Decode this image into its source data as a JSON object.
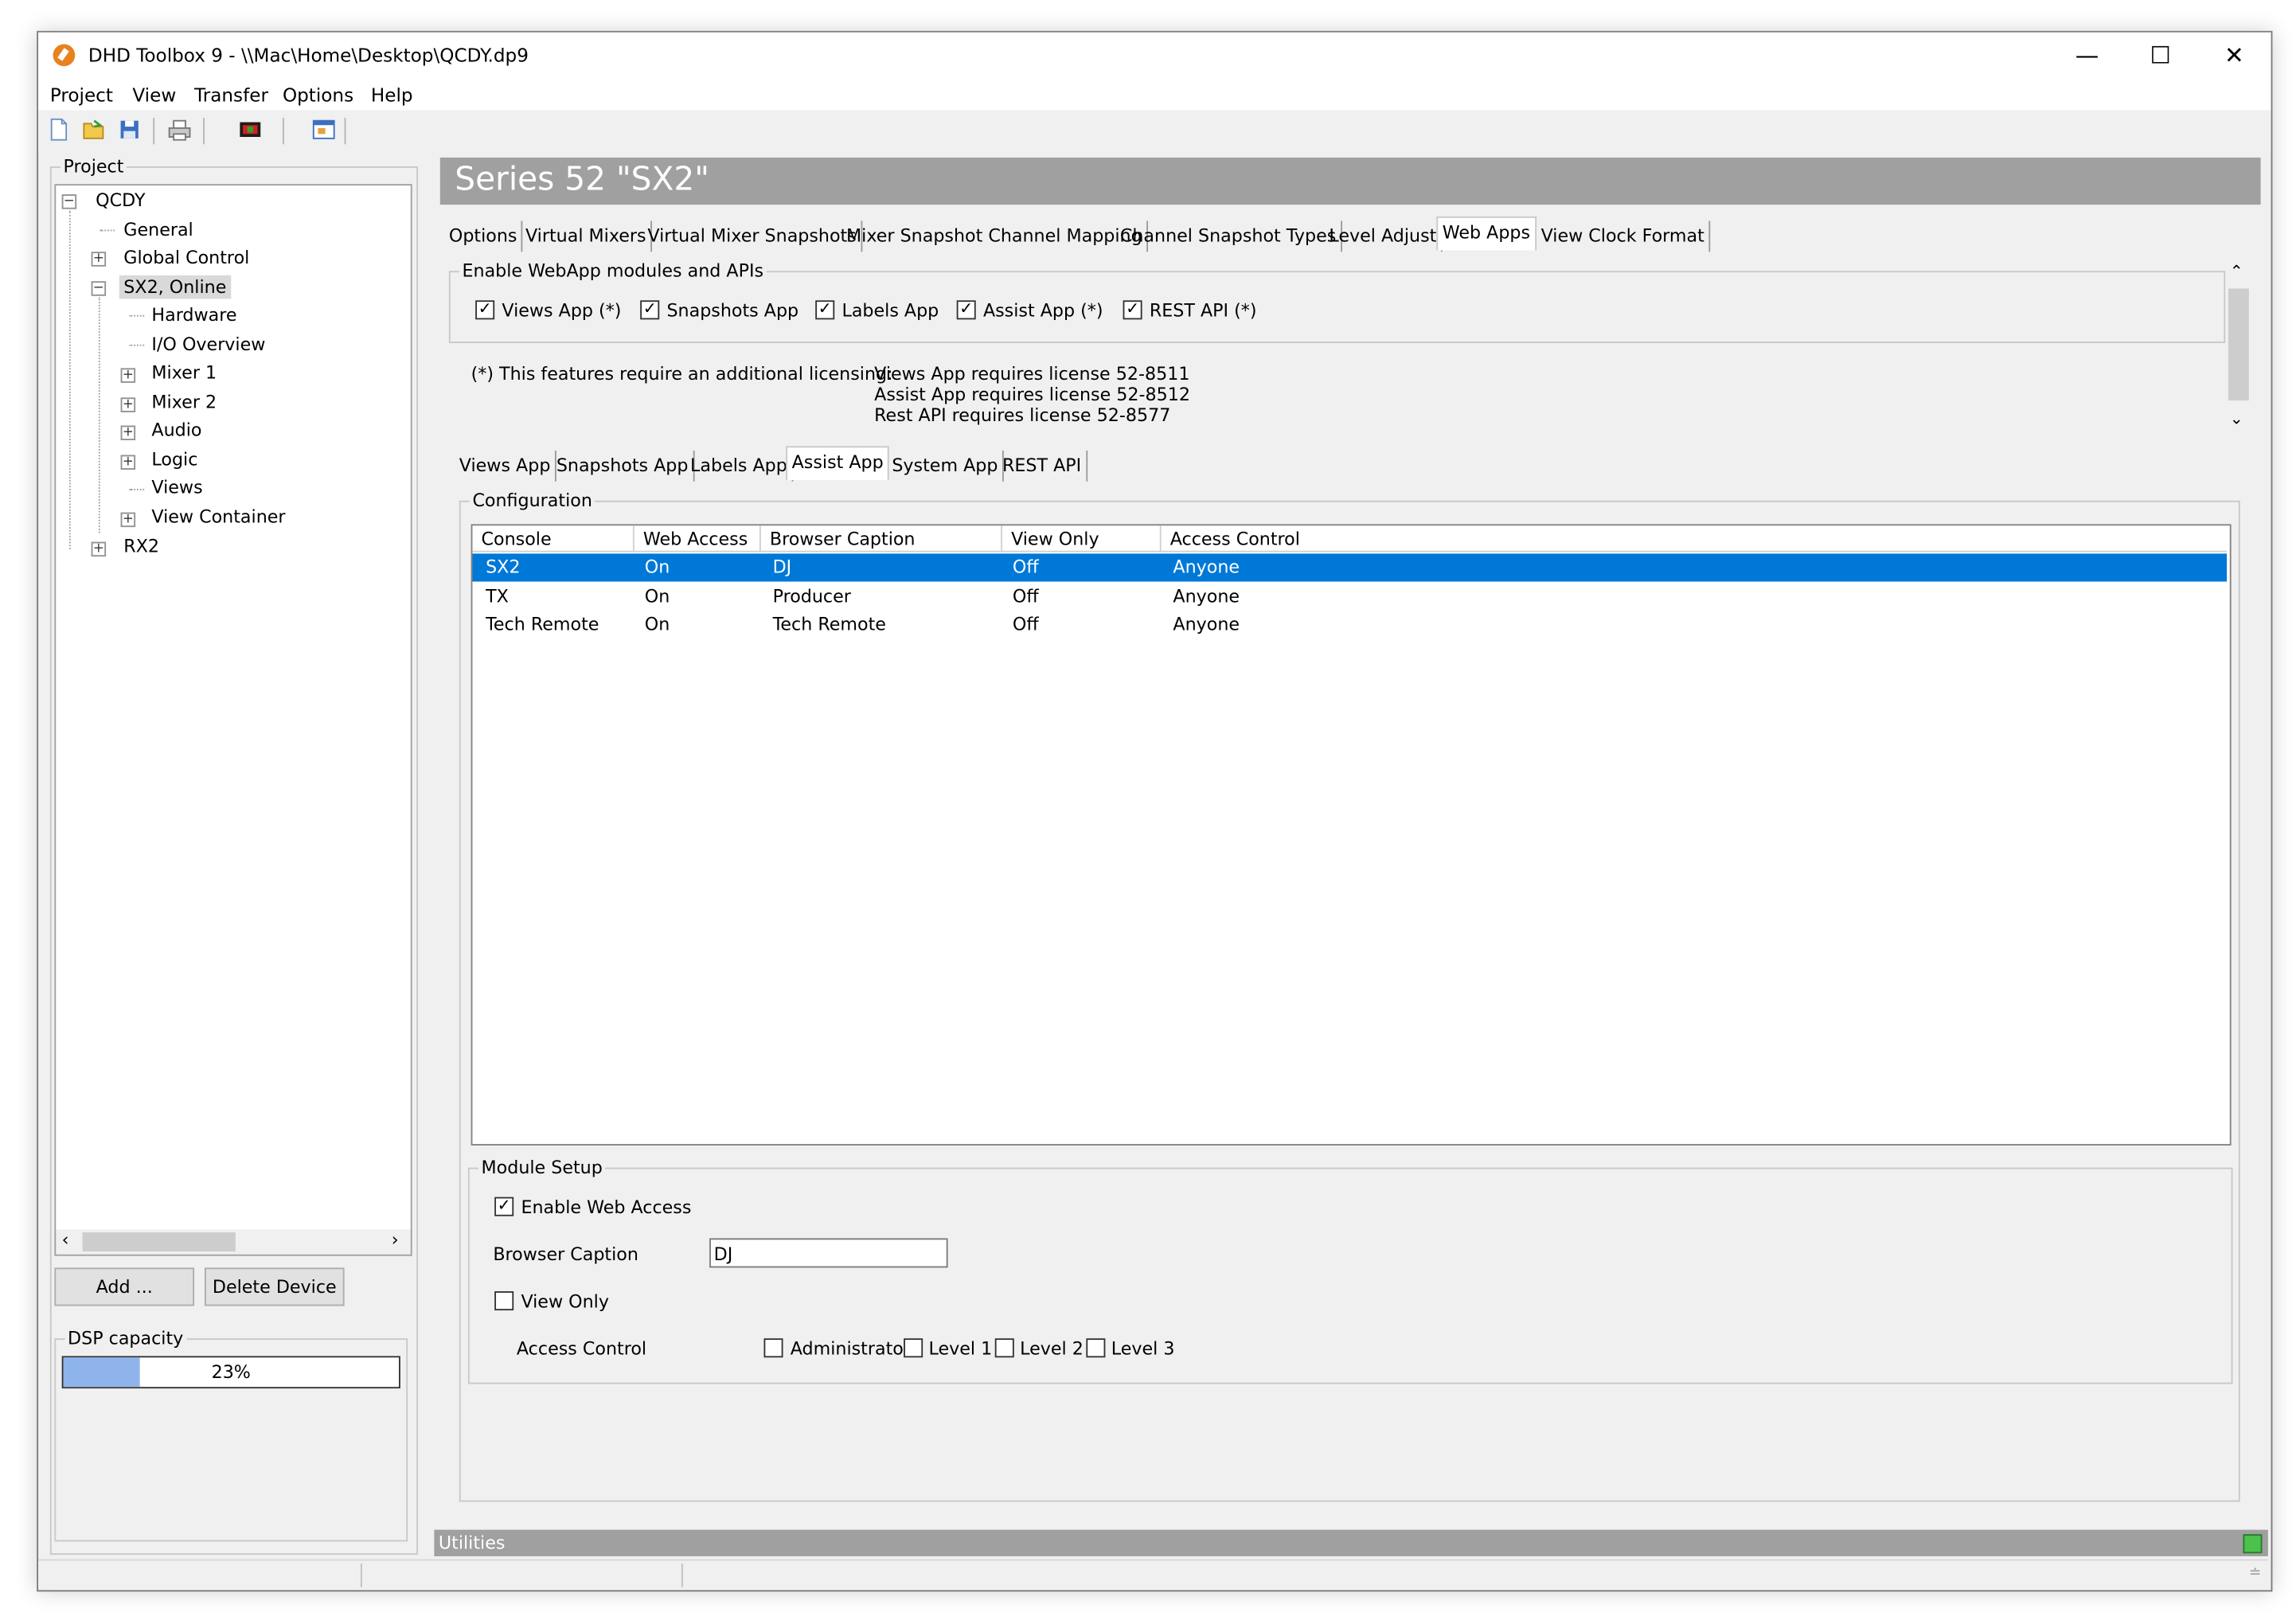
{
  "window": {
    "title": "DHD Toolbox 9 - \\\\Mac\\Home\\Desktop\\QCDY.dp9"
  },
  "menu": [
    "Project",
    "View",
    "Transfer",
    "Options",
    "Help"
  ],
  "project_panel": {
    "legend": "Project",
    "tree": {
      "root": "QCDY",
      "items": [
        "General",
        "Global Control",
        "SX2, Online",
        "Hardware",
        "I/O Overview",
        "Mixer 1",
        "Mixer 2",
        "Audio",
        "Logic",
        "Views",
        "View Container",
        "RX2"
      ]
    },
    "add_button": "Add ...",
    "delete_button": "Delete Device",
    "dsp_legend": "DSP capacity",
    "dsp_percent_label": "23%",
    "dsp_fraction": 0.23
  },
  "device_header": "Series 52 \"SX2\"",
  "main_tabs": [
    "Options",
    "Virtual Mixers",
    "Virtual Mixer Snapshots",
    "Mixer Snapshot Channel Mapping",
    "Channel Snapshot Types",
    "Level Adjust",
    "Web Apps",
    "View Clock Format"
  ],
  "active_main_tab": "Web Apps",
  "webapps": {
    "legend": "Enable WebApp modules and APIs",
    "modules": [
      {
        "label": "Views App (*)",
        "checked": true
      },
      {
        "label": "Snapshots App",
        "checked": true
      },
      {
        "label": "Labels App",
        "checked": true
      },
      {
        "label": "Assist App (*)",
        "checked": true
      },
      {
        "label": "REST API (*)",
        "checked": true
      }
    ],
    "license_note": "(*) This features require an additional licensing:",
    "license_lines": [
      "Views App requires license 52-8511",
      "Assist App requires license 52-8512",
      "Rest API requires license 52-8577"
    ]
  },
  "sub_tabs": [
    "Views App",
    "Snapshots App",
    "Labels App",
    "Assist App",
    "System App",
    "REST API"
  ],
  "active_sub_tab": "Assist App",
  "configuration": {
    "legend": "Configuration",
    "columns": [
      "Console",
      "Web Access",
      "Browser Caption",
      "View Only",
      "Access Control"
    ],
    "rows": [
      [
        "SX2",
        "On",
        "DJ",
        "Off",
        "Anyone"
      ],
      [
        "TX",
        "On",
        "Producer",
        "Off",
        "Anyone"
      ],
      [
        "Tech Remote",
        "On",
        "Tech Remote",
        "Off",
        "Anyone"
      ]
    ],
    "selected_row": 0
  },
  "module_setup": {
    "legend": "Module Setup",
    "enable_web_access_label": "Enable Web Access",
    "enable_web_access_checked": true,
    "browser_caption_label": "Browser Caption",
    "browser_caption_value": "DJ",
    "view_only_label": "View Only",
    "view_only_checked": false,
    "access_control_label": "Access Control",
    "access_levels": [
      {
        "label": "Administrator",
        "checked": false
      },
      {
        "label": "Level 1",
        "checked": false
      },
      {
        "label": "Level 2",
        "checked": false
      },
      {
        "label": "Level 3",
        "checked": false
      }
    ]
  },
  "utilities_label": "Utilities",
  "colors": {
    "selection": "#0078d7",
    "header_bar": "#a0a0a0",
    "dsp_bar": "#8fb4ec"
  },
  "icons": [
    "new-file-icon",
    "open-folder-icon",
    "save-icon",
    "print-icon",
    "transfer-icon",
    "window-icon",
    "minimize-icon",
    "maximize-icon",
    "close-icon"
  ]
}
